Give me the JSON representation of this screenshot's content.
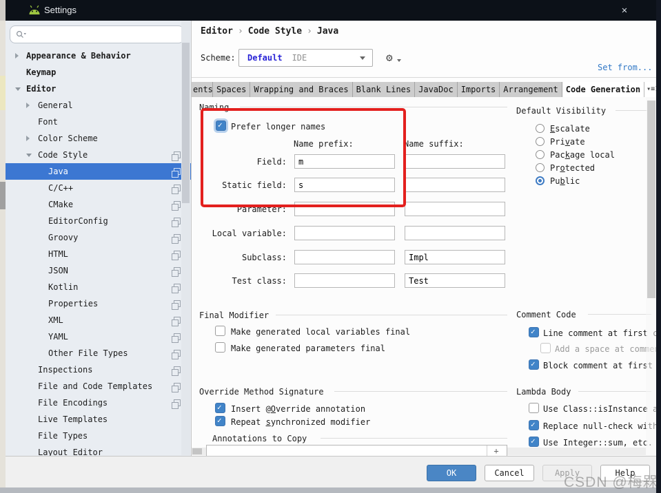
{
  "window": {
    "title": "Settings",
    "close_glyph": "✕"
  },
  "sidebar": {
    "search_value": "",
    "items": [
      {
        "label": "Appearance & Behavior",
        "level": 0,
        "arrow": "collapsed",
        "bold": true
      },
      {
        "label": "Keymap",
        "level": 0,
        "bold": true
      },
      {
        "label": "Editor",
        "level": 0,
        "arrow": "expanded",
        "bold": true
      },
      {
        "label": "General",
        "level": 1,
        "arrow": "collapsed"
      },
      {
        "label": "Font",
        "level": 1
      },
      {
        "label": "Color Scheme",
        "level": 1,
        "arrow": "collapsed"
      },
      {
        "label": "Code Style",
        "level": 1,
        "arrow": "expanded",
        "copy_icon": true
      },
      {
        "label": "Java",
        "level": 2,
        "copy_icon": true,
        "selected": true
      },
      {
        "label": "C/C++",
        "level": 2,
        "copy_icon": true
      },
      {
        "label": "CMake",
        "level": 2,
        "copy_icon": true
      },
      {
        "label": "EditorConfig",
        "level": 2,
        "copy_icon": true
      },
      {
        "label": "Groovy",
        "level": 2,
        "copy_icon": true
      },
      {
        "label": "HTML",
        "level": 2,
        "copy_icon": true
      },
      {
        "label": "JSON",
        "level": 2,
        "copy_icon": true
      },
      {
        "label": "Kotlin",
        "level": 2,
        "copy_icon": true
      },
      {
        "label": "Properties",
        "level": 2,
        "copy_icon": true
      },
      {
        "label": "XML",
        "level": 2,
        "copy_icon": true
      },
      {
        "label": "YAML",
        "level": 2,
        "copy_icon": true
      },
      {
        "label": "Other File Types",
        "level": 2,
        "copy_icon": true
      },
      {
        "label": "Inspections",
        "level": 1,
        "copy_icon": true
      },
      {
        "label": "File and Code Templates",
        "level": 1,
        "copy_icon": true
      },
      {
        "label": "File Encodings",
        "level": 1,
        "copy_icon": true
      },
      {
        "label": "Live Templates",
        "level": 1
      },
      {
        "label": "File Types",
        "level": 1
      },
      {
        "label": "Layout Editor",
        "level": 1
      }
    ]
  },
  "header": {
    "breadcrumb": [
      "Editor",
      "Code Style",
      "Java"
    ],
    "breadcrumb_sep": "›",
    "scheme_label": "Scheme:",
    "scheme_name": "Default",
    "scheme_kind": "IDE",
    "set_from_link": "Set from..."
  },
  "tabs": {
    "items": [
      "ents",
      "Spaces",
      "Wrapping and Braces",
      "Blank Lines",
      "JavaDoc",
      "Imports",
      "Arrangement",
      "Code Generation"
    ],
    "selected": "Code Generation",
    "overflow_glyph": "▾≡",
    "overflow_count": "1"
  },
  "naming": {
    "section": "Naming",
    "prefer_longer_names": {
      "label": "Prefer longer names",
      "checked": true
    },
    "col_prefix": "Name prefix:",
    "col_suffix": "Name suffix:",
    "rows": [
      {
        "label": "Field:",
        "prefix": "m",
        "suffix": ""
      },
      {
        "label": "Static field:",
        "prefix": "s",
        "suffix": ""
      },
      {
        "label": "Parameter:",
        "prefix": "",
        "suffix": ""
      },
      {
        "label": "Local variable:",
        "prefix": "",
        "suffix": ""
      },
      {
        "label": "Subclass:",
        "prefix": "",
        "suffix": "Impl"
      },
      {
        "label": "Test class:",
        "prefix": "",
        "suffix": "Test"
      }
    ]
  },
  "visibility": {
    "section": "Default Visibility",
    "selected": "Public",
    "options": [
      {
        "label": "Escalate",
        "mnemonic": "E",
        "selected": false
      },
      {
        "label": "Private",
        "mnemonic": "v",
        "selected": false
      },
      {
        "label": "Package local",
        "mnemonic": "k",
        "selected": false
      },
      {
        "label": "Protected",
        "mnemonic": "o",
        "selected": false
      },
      {
        "label": "Public",
        "mnemonic": "b",
        "selected": true
      }
    ]
  },
  "final_modifier": {
    "section": "Final Modifier",
    "options": [
      {
        "label": "Make generated local variables final",
        "checked": false
      },
      {
        "label": "Make generated parameters final",
        "checked": false
      }
    ]
  },
  "comment_code": {
    "section": "Comment Code",
    "options": [
      {
        "label": "Line comment at first col",
        "checked": true
      },
      {
        "label": "Add a space at comment",
        "checked": false,
        "disabled": true
      },
      {
        "label": "Block comment at first co",
        "checked": true
      }
    ]
  },
  "override_signature": {
    "section": "Override Method Signature",
    "options": [
      {
        "label": "Insert @Override annotation",
        "mnemonic": "O",
        "checked": true
      },
      {
        "label": "Repeat synchronized modifier",
        "mnemonic": "s",
        "checked": true
      }
    ]
  },
  "annotations": {
    "section": "Annotations to Copy",
    "add_glyph": "+"
  },
  "lambda": {
    "section": "Lambda Body",
    "options": [
      {
        "label": "Use Class::isInstance and",
        "checked": false
      },
      {
        "label": "Replace null-check with (",
        "checked": true
      },
      {
        "label": "Use Integer::sum, etc. wh",
        "checked": true
      }
    ]
  },
  "footer": {
    "ok": "OK",
    "cancel": "Cancel",
    "apply": "Apply",
    "help": "Help"
  },
  "watermark": "CSDN @梅槑"
}
